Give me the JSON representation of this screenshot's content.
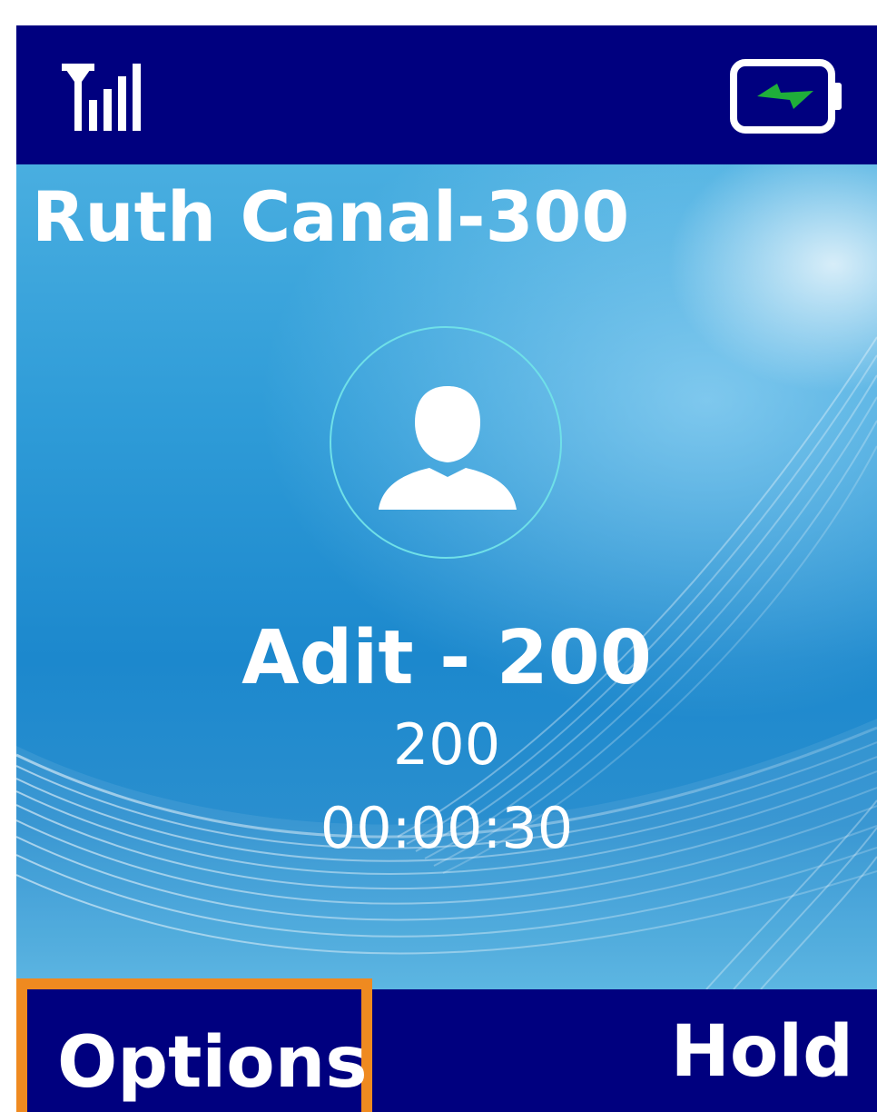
{
  "status_bar": {
    "signal_icon": "signal-strength-icon",
    "battery_icon": "battery-charging-icon",
    "battery_color": "#1fae3a"
  },
  "device": {
    "name": "Ruth Canal-300"
  },
  "call": {
    "avatar_icon": "contact-avatar-icon",
    "caller_name": "Adit - 200",
    "caller_number": "200",
    "duration": "00:00:30"
  },
  "softkeys": {
    "left_label": "Options",
    "right_label": "Hold",
    "highlight_color": "#ef8a20"
  }
}
